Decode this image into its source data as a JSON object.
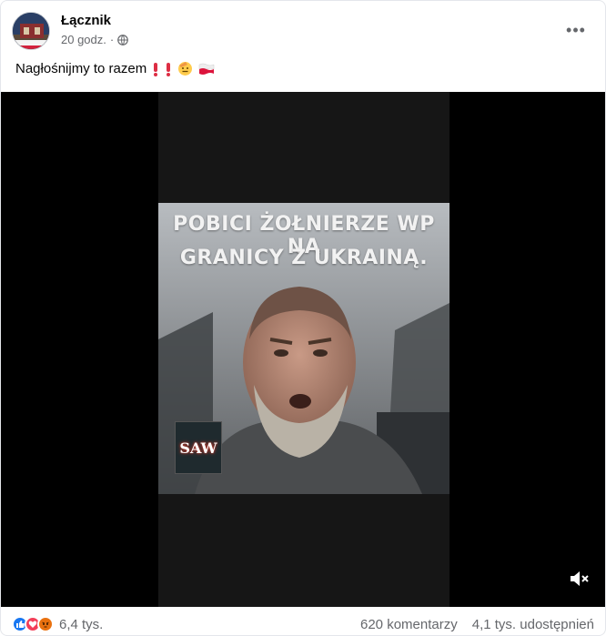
{
  "post": {
    "author": "Łącznik",
    "time": "20 godz.",
    "separator": "·",
    "caption": "Nagłośnijmy to razem",
    "caption_emojis": [
      "exclamation-icon",
      "exclamation-icon",
      "saluting-face-icon",
      "poland-flag-icon"
    ],
    "more_label": "•••"
  },
  "video": {
    "overlay_line1": "POBICI ŻOŁNIERZE WP NA",
    "overlay_line2": "GRANICY Z UKRAINĄ.",
    "logo_text": "SAW"
  },
  "footer": {
    "reactions": [
      "like-icon",
      "love-icon",
      "angry-icon"
    ],
    "reaction_count": "6,4 tys.",
    "comments": "620 komentarzy",
    "shares": "4,1 tys. udostępnień"
  },
  "colors": {
    "brand_blue": "#1877f2",
    "love_red": "#f33e58",
    "angry_orange": "#e9710f",
    "secondary_text": "#65676b"
  }
}
